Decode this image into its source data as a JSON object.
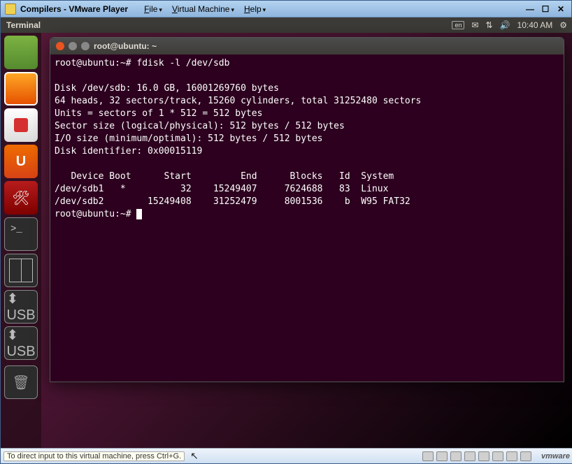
{
  "vmware": {
    "title": "Compilers - VMware Player",
    "menus": {
      "file": "File",
      "vm": "Virtual Machine",
      "help": "Help"
    },
    "status_hint": "To direct input to this virtual machine, press Ctrl+G.",
    "brand": "vmware"
  },
  "ubuntu_panel": {
    "app_title": "Terminal",
    "lang": "en",
    "time": "10:40 AM"
  },
  "terminal": {
    "title": "root@ubuntu: ~",
    "prompt": "root@ubuntu:~# ",
    "command": "fdisk -l /dev/sdb",
    "blank": "",
    "disk_header": "Disk /dev/sdb: 16.0 GB, 16001269760 bytes",
    "geom": "64 heads, 32 sectors/track, 15260 cylinders, total 31252480 sectors",
    "units": "Units = sectors of 1 * 512 = 512 bytes",
    "sector": "Sector size (logical/physical): 512 bytes / 512 bytes",
    "io": "I/O size (minimum/optimal): 512 bytes / 512 bytes",
    "ident": "Disk identifier: 0x00015119",
    "table_header": "   Device Boot      Start         End      Blocks   Id  System",
    "row1": "/dev/sdb1   *          32    15249407     7624688   83  Linux",
    "row2": "/dev/sdb2        15249408    31252479     8001536    b  W95 FAT32"
  },
  "fdisk_table": {
    "columns": [
      "Device",
      "Boot",
      "Start",
      "End",
      "Blocks",
      "Id",
      "System"
    ],
    "rows": [
      {
        "device": "/dev/sdb1",
        "boot": "*",
        "start": 32,
        "end": 15249407,
        "blocks": 7624688,
        "id": "83",
        "system": "Linux"
      },
      {
        "device": "/dev/sdb2",
        "boot": "",
        "start": 15249408,
        "end": 31252479,
        "blocks": 8001536,
        "id": "b",
        "system": "W95 FAT32"
      }
    ]
  },
  "launcher": {
    "items": [
      "libreoffice-calc",
      "libreoffice-impress",
      "software-center",
      "ubuntu-one",
      "system-settings",
      "terminal",
      "workspace-switcher",
      "usb-1",
      "usb-2",
      "trash"
    ]
  }
}
